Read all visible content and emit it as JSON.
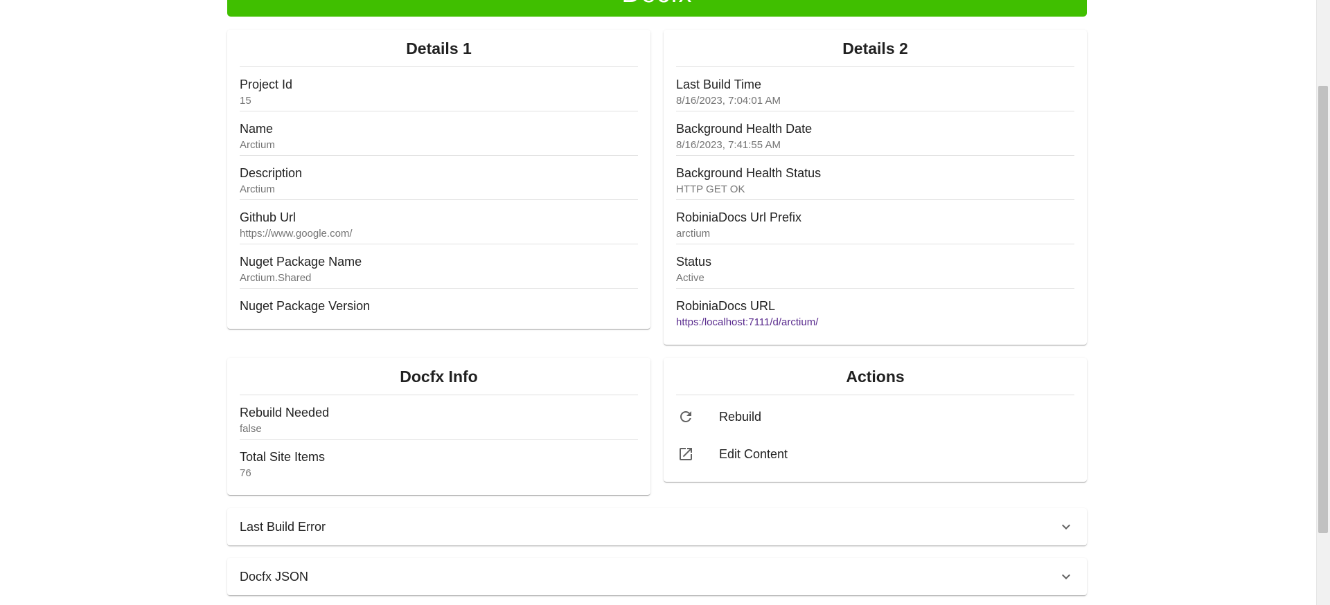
{
  "banner": {
    "title": "Docfx"
  },
  "details1": {
    "title": "Details 1",
    "fields": [
      {
        "label": "Project Id",
        "value": "15"
      },
      {
        "label": "Name",
        "value": "Arctium"
      },
      {
        "label": "Description",
        "value": "Arctium"
      },
      {
        "label": "Github Url",
        "value": "https://www.google.com/"
      },
      {
        "label": "Nuget Package Name",
        "value": "Arctium.Shared"
      },
      {
        "label": "Nuget Package Version",
        "value": ""
      }
    ]
  },
  "details2": {
    "title": "Details 2",
    "fields": [
      {
        "label": "Last Build Time",
        "value": "8/16/2023, 7:04:01 AM"
      },
      {
        "label": "Background Health Date",
        "value": "8/16/2023, 7:41:55 AM"
      },
      {
        "label": "Background Health Status",
        "value": "HTTP GET OK"
      },
      {
        "label": "RobiniaDocs Url Prefix",
        "value": "arctium"
      },
      {
        "label": "Status",
        "value": "Active"
      },
      {
        "label": "RobiniaDocs URL",
        "value": "https:/localhost:7111/d/arctium/"
      }
    ]
  },
  "docfx_info": {
    "title": "Docfx Info",
    "fields": [
      {
        "label": "Rebuild Needed",
        "value": "false"
      },
      {
        "label": "Total Site Items",
        "value": "76"
      }
    ]
  },
  "actions": {
    "title": "Actions",
    "items": [
      {
        "label": "Rebuild",
        "icon": "refresh-icon"
      },
      {
        "label": "Edit Content",
        "icon": "open-in-new-icon"
      }
    ]
  },
  "panels": [
    {
      "title": "Last Build Error",
      "icon": "chevron-down-icon"
    },
    {
      "title": "Docfx JSON",
      "icon": "chevron-down-icon"
    }
  ],
  "colors": {
    "banner": "#40bf00",
    "link": "#5a2c8e",
    "muted": "#757575"
  }
}
